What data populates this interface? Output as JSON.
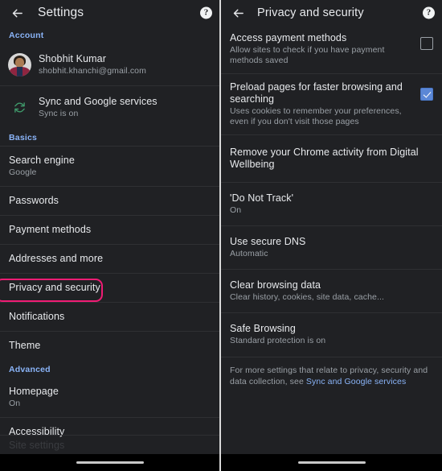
{
  "left_panel": {
    "appbar": {
      "back_icon": "arrow-left-icon",
      "title": "Settings",
      "help_icon": "help-circle-icon",
      "help_glyph": "?"
    },
    "sections": [
      {
        "header": "Account"
      }
    ],
    "account": {
      "avatar_name": "user-avatar",
      "name": "Shobhit Kumar",
      "email": "shobhit.khanchi@gmail.com"
    },
    "sync": {
      "icon": "sync-icon",
      "title": "Sync and Google services",
      "subtitle": "Sync is on"
    },
    "basics_header": "Basics",
    "basics_items": [
      {
        "title": "Search engine",
        "subtitle": "Google"
      },
      {
        "title": "Passwords",
        "subtitle": ""
      },
      {
        "title": "Payment methods",
        "subtitle": ""
      },
      {
        "title": "Addresses and more",
        "subtitle": ""
      },
      {
        "title": "Privacy and security",
        "subtitle": ""
      },
      {
        "title": "Notifications",
        "subtitle": ""
      },
      {
        "title": "Theme",
        "subtitle": ""
      }
    ],
    "advanced_header": "Advanced",
    "advanced_items": [
      {
        "title": "Homepage",
        "subtitle": "On"
      },
      {
        "title": "Accessibility",
        "subtitle": ""
      }
    ],
    "partial_item": {
      "title": "Site settings"
    }
  },
  "right_panel": {
    "appbar": {
      "back_icon": "arrow-left-icon",
      "title": "Privacy and security",
      "help_icon": "help-circle-icon",
      "help_glyph": "?"
    },
    "items": [
      {
        "title": "Access payment methods",
        "subtitle": "Allow sites to check if you have payment methods saved",
        "control": "checkbox",
        "checked": false
      },
      {
        "title": "Preload pages for faster browsing and searching",
        "subtitle": "Uses cookies to remember your preferences, even if you don't visit those pages",
        "control": "checkbox",
        "checked": true
      },
      {
        "title": "Remove your Chrome activity from Digital Wellbeing",
        "subtitle": "",
        "control": "none",
        "checked": false
      },
      {
        "title": "'Do Not Track'",
        "subtitle": "On",
        "control": "none",
        "checked": false
      },
      {
        "title": "Use secure DNS",
        "subtitle": "Automatic",
        "control": "none",
        "checked": false
      },
      {
        "title": "Clear browsing data",
        "subtitle": "Clear history, cookies, site data, cache...",
        "control": "none",
        "checked": false
      },
      {
        "title": "Safe Browsing",
        "subtitle": "Standard protection is on",
        "control": "none",
        "checked": false
      }
    ],
    "footnote": {
      "text_before": "For more settings that relate to privacy, security and data collection, see ",
      "link": "Sync and Google services"
    }
  },
  "annotations": {
    "highlight_color": "#ef1c74",
    "highlight_left_target": "Privacy and security",
    "highlight_right_target": "Safe Browsing"
  },
  "colors": {
    "background": "#202124",
    "text_primary": "#e8eaed",
    "text_secondary": "#9aa0a6",
    "accent_blue": "#8ab4f8",
    "checkbox_checked": "#5b87d6",
    "sync_green": "#3f9a6b",
    "annotation_pink": "#ef1c74"
  },
  "system": {
    "home_indicator": "home-indicator"
  }
}
